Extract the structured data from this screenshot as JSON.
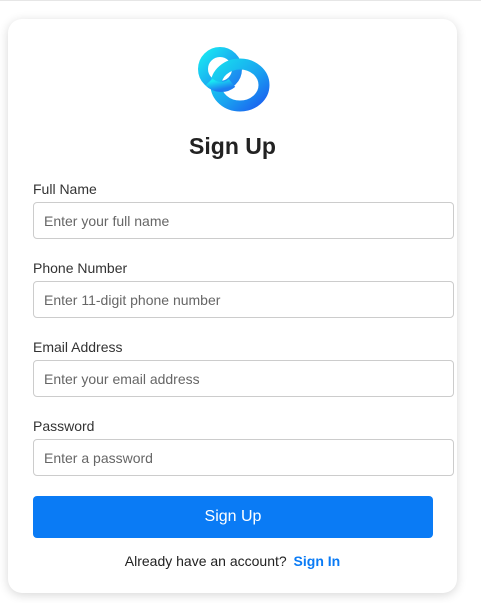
{
  "form": {
    "title": "Sign Up",
    "fields": [
      {
        "label": "Full Name",
        "placeholder": "Enter your full name",
        "value": ""
      },
      {
        "label": "Phone Number",
        "placeholder": "Enter 11-digit phone number",
        "value": ""
      },
      {
        "label": "Email Address",
        "placeholder": "Enter your email address",
        "value": ""
      },
      {
        "label": "Password",
        "placeholder": "Enter a password",
        "value": ""
      }
    ],
    "submit_label": "Sign Up",
    "signin_prompt": "Already have an account?",
    "signin_link": "Sign In"
  },
  "icons": {
    "logo": "interlocking-rings-logo"
  },
  "colors": {
    "accent": "#0a7bf5",
    "logo_cyan": "#19e0f0",
    "logo_blue": "#1a6ef2",
    "card_background": "#ffffff"
  }
}
